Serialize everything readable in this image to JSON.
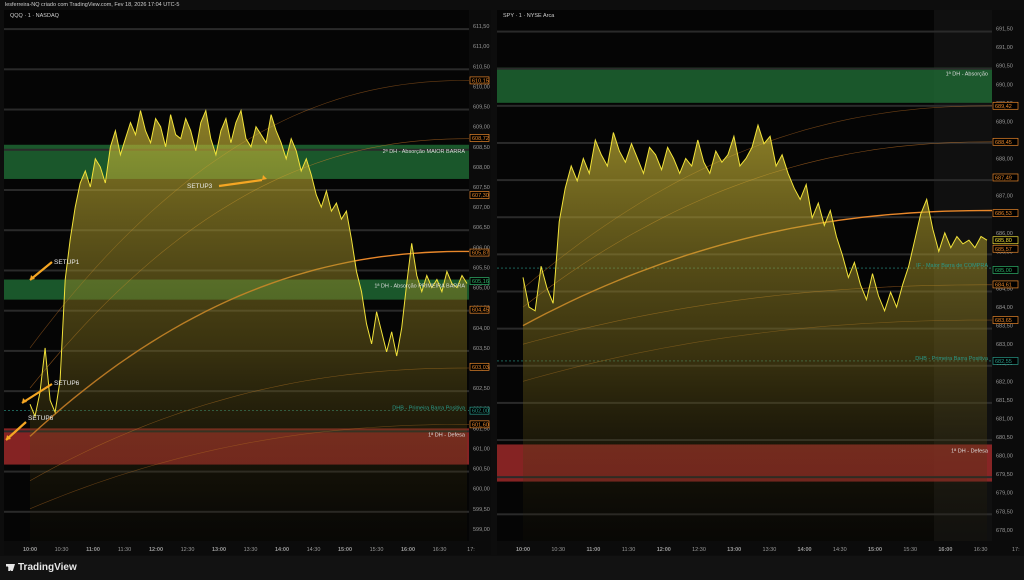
{
  "header": {
    "title": "lesferreira-NQ criado com TradingView.com, Fev 18, 2026 17:04 UTC-5"
  },
  "footer": {
    "brand": "TradingView"
  },
  "colors": {
    "price_line": "#f2e33a",
    "vwap": "#e8872a",
    "green_zone": "#1f6b35",
    "red_zone": "#a52a2a",
    "axis_text": "#9a9a9a"
  },
  "left_chart": {
    "symbol": "QQQ · 1 · NASDAQ",
    "y_ticks": [
      "611,50",
      "611,00",
      "610,50",
      "610,00",
      "609,50",
      "609,00",
      "608,50",
      "608,00",
      "607,50",
      "607,00",
      "606,50",
      "606,00",
      "605,50",
      "605,00",
      "604,50",
      "604,00",
      "603,50",
      "603,00",
      "602,50",
      "602,00",
      "601,50",
      "601,00",
      "600,50",
      "600,00",
      "599,50",
      "599,00"
    ],
    "price_labels": [
      {
        "text": "610,15",
        "color": "#e8872a",
        "value": 610.15
      },
      {
        "text": "608,72",
        "color": "#e8872a",
        "value": 608.72
      },
      {
        "text": "607,30",
        "color": "#e8872a",
        "value": 607.3
      },
      {
        "text": "605,87",
        "color": "#e8872a",
        "value": 605.87
      },
      {
        "text": "605,16",
        "color": "#2fb36a",
        "value": 605.16
      },
      {
        "text": "604,45",
        "color": "#e8872a",
        "value": 604.45
      },
      {
        "text": "603,03",
        "color": "#e8872a",
        "value": 603.03
      },
      {
        "text": "602,00",
        "color": "#2a9a8a",
        "value": 601.94
      },
      {
        "text": "601,60",
        "color": "#e8872a",
        "value": 601.6
      }
    ],
    "x_ticks": [
      "10:00",
      "10:30",
      "11:00",
      "11:30",
      "12:00",
      "12:30",
      "13:00",
      "13:30",
      "14:00",
      "14:30",
      "15:00",
      "15:30",
      "16:00",
      "16:30",
      "17:"
    ],
    "zones": [
      {
        "label": "2ª DH - Absorção MAIOR BARRA",
        "kind": "green",
        "top": 608.55,
        "bottom": 607.7
      },
      {
        "label": "1ª DH - Absorção PRIMEIRA BARRA",
        "kind": "green",
        "top": 605.2,
        "bottom": 604.7
      },
      {
        "label": "DHB - Primeira Barra Positiva",
        "kind": "teal",
        "top": 601.94,
        "bottom": 601.94
      },
      {
        "label": "1ª DH - Defesa",
        "kind": "red",
        "top": 601.5,
        "bottom": 600.6
      }
    ],
    "annotations": [
      "SETUP1",
      "SETUP3",
      "SETUP6",
      "SETUP6"
    ],
    "y_range": [
      598.7,
      611.9
    ],
    "series": [
      602.1,
      601.8,
      602.4,
      603.5,
      602.2,
      601.9,
      602.7,
      605.2,
      606.2,
      607.0,
      607.6,
      607.9,
      607.5,
      608.2,
      608.0,
      607.6,
      608.5,
      608.9,
      608.3,
      608.7,
      609.1,
      608.8,
      609.4,
      608.9,
      608.6,
      609.2,
      609.0,
      608.5,
      609.3,
      608.8,
      608.7,
      609.2,
      608.9,
      608.4,
      609.1,
      609.4,
      608.7,
      608.3,
      608.9,
      609.2,
      608.6,
      609.1,
      609.4,
      608.7,
      608.5,
      609.0,
      608.8,
      608.6,
      609.3,
      608.9,
      608.6,
      608.2,
      608.7,
      608.4,
      607.9,
      608.2,
      607.8,
      607.3,
      607.0,
      607.4,
      606.9,
      607.1,
      606.7,
      606.9,
      606.2,
      605.4,
      604.9,
      604.1,
      603.6,
      604.4,
      603.9,
      603.4,
      603.9,
      603.3,
      604.0,
      605.1,
      606.1,
      605.3,
      604.9,
      605.3,
      605.0,
      605.2,
      604.9,
      605.4,
      605.1,
      605.0,
      605.3,
      605.1
    ]
  },
  "right_chart": {
    "symbol": "SPY · 1 · NYSE Arca",
    "y_ticks": [
      "691,50",
      "691,00",
      "690,50",
      "690,00",
      "689,50",
      "689,00",
      "688,50",
      "688,00",
      "687,50",
      "687,00",
      "686,50",
      "686,00",
      "685,50",
      "685,00",
      "684,50",
      "684,00",
      "683,50",
      "683,00",
      "682,50",
      "682,00",
      "681,50",
      "681,00",
      "680,50",
      "680,00",
      "679,50",
      "679,00",
      "678,50",
      "678,00"
    ],
    "price_labels": [
      {
        "text": "689,42",
        "color": "#e8872a",
        "value": 689.42
      },
      {
        "text": "688,45",
        "color": "#e8872a",
        "value": 688.45
      },
      {
        "text": "687,49",
        "color": "#e8872a",
        "value": 687.49
      },
      {
        "text": "686,53",
        "color": "#e8872a",
        "value": 686.53
      },
      {
        "text": "685,80",
        "color": "#f2e33a",
        "value": 685.8
      },
      {
        "text": "685,57",
        "color": "#e8872a",
        "value": 685.57
      },
      {
        "text": "685,00",
        "color": "#2fb36a",
        "value": 685.0
      },
      {
        "text": "684,61",
        "color": "#e8872a",
        "value": 684.61
      },
      {
        "text": "683,65",
        "color": "#e8872a",
        "value": 683.65
      },
      {
        "text": "682,55",
        "color": "#2a9a8a",
        "value": 682.55
      }
    ],
    "x_ticks": [
      "10:00",
      "10:30",
      "11:00",
      "11:30",
      "12:00",
      "12:30",
      "13:00",
      "13:30",
      "14:00",
      "14:30",
      "15:00",
      "15:30",
      "16:00",
      "16:30",
      "17:"
    ],
    "zones": [
      {
        "label": "1ª DH - Absorção",
        "kind": "green",
        "top": 690.45,
        "bottom": 689.5
      },
      {
        "label": "IF - Maior Barra de COMPRA",
        "kind": "teal",
        "top": 685.05,
        "bottom": 684.95
      },
      {
        "label": "DHB - Primeira Barra Positiva",
        "kind": "teal",
        "top": 682.55,
        "bottom": 682.55
      },
      {
        "label": "1ª DH - Defesa",
        "kind": "red",
        "top": 680.3,
        "bottom": 679.3
      }
    ],
    "y_range": [
      677.7,
      692.0
    ],
    "series": [
      684.8,
      684.0,
      683.9,
      685.1,
      684.5,
      684.1,
      686.3,
      687.2,
      687.8,
      687.4,
      688.0,
      687.6,
      688.5,
      688.1,
      687.8,
      688.7,
      688.2,
      687.9,
      688.4,
      688.0,
      687.6,
      688.3,
      688.1,
      687.7,
      688.3,
      688.0,
      687.6,
      688.0,
      687.8,
      688.5,
      687.9,
      687.6,
      688.2,
      687.9,
      688.1,
      688.6,
      687.8,
      688.0,
      688.3,
      688.9,
      688.4,
      688.6,
      687.8,
      688.1,
      687.6,
      687.2,
      686.9,
      687.3,
      686.4,
      686.8,
      686.2,
      686.6,
      685.9,
      685.4,
      684.8,
      685.2,
      684.6,
      684.2,
      684.9,
      684.3,
      683.9,
      684.4,
      684.0,
      684.6,
      685.1,
      685.8,
      686.5,
      686.9,
      686.1,
      685.5,
      686.0,
      685.6,
      685.9,
      685.7,
      685.8,
      685.6,
      685.9,
      685.8
    ]
  }
}
